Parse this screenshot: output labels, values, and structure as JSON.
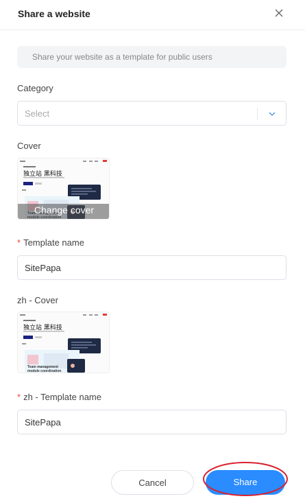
{
  "dialog": {
    "title": "Share a website",
    "notice": "Share your website as a template for public users"
  },
  "fields": {
    "category_label": "Category",
    "category_placeholder": "Select",
    "cover_label": "Cover",
    "change_cover": "Change cover",
    "template_name_label": "Template name",
    "template_name_value": "SitePapa",
    "zh_cover_label": "zh - Cover",
    "zh_template_name_label": "zh - Template name",
    "zh_template_name_value": "SitePapa",
    "required_mark": "*"
  },
  "thumbnail": {
    "headline": "独立站 黑科技",
    "caption_line1": "Team management",
    "caption_line2": "module coordination"
  },
  "footer": {
    "cancel_label": "Cancel",
    "share_label": "Share"
  },
  "icons": {
    "close": "close-icon",
    "dropdown": "chevron-down-icon"
  },
  "colors": {
    "primary": "#2a8cff",
    "required": "#e64a3b",
    "annotation": "#d9202f"
  }
}
